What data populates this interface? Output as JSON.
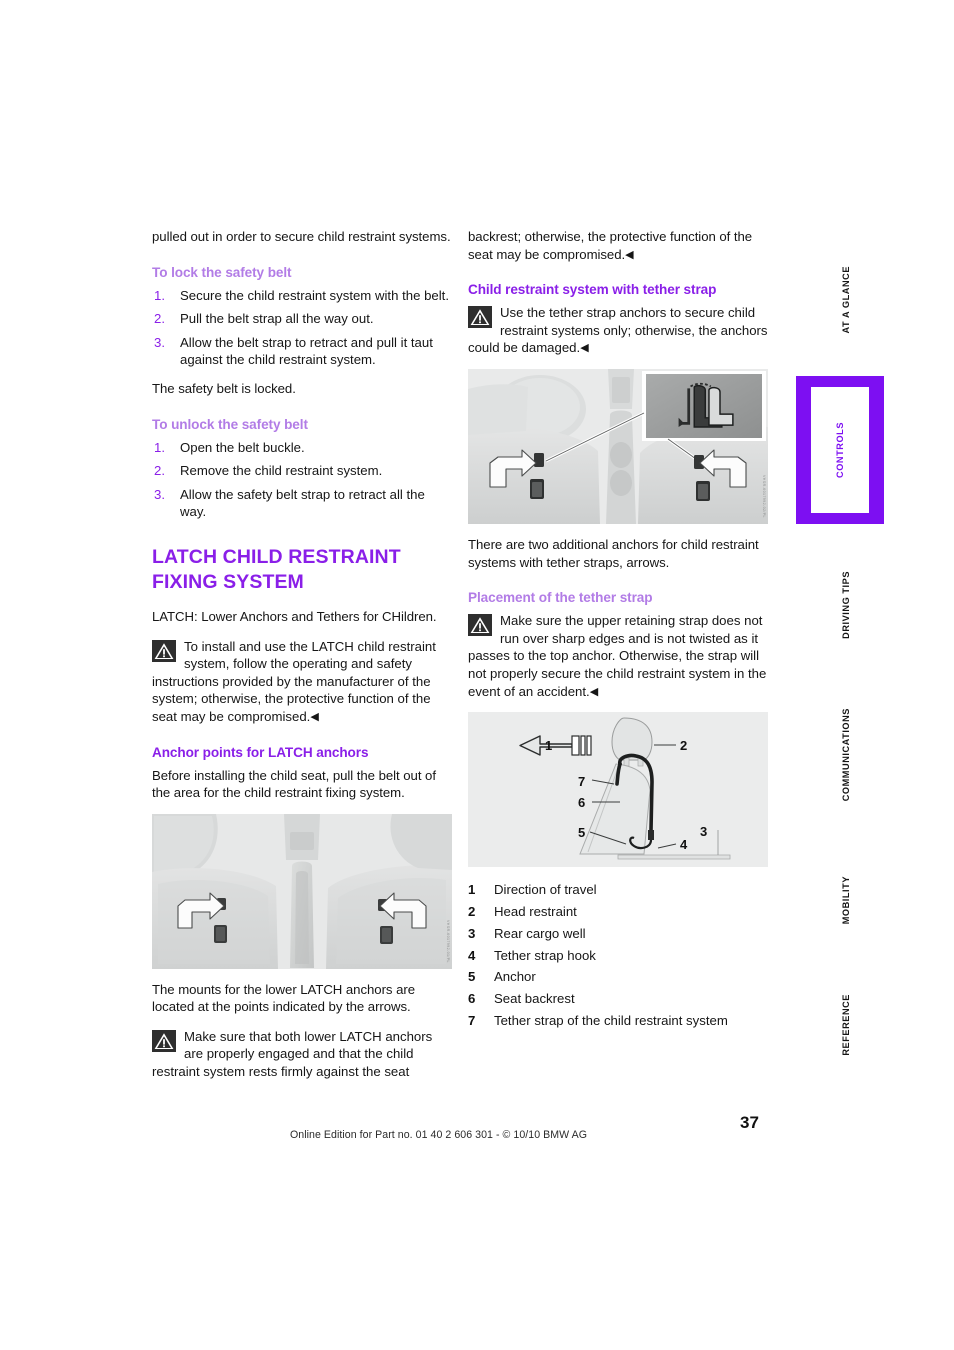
{
  "page": {
    "number": "37",
    "footer": "Online Edition for Part no. 01 40 2 606 301 - © 10/10 BMW AG"
  },
  "left_column": {
    "continued_paragraph": "pulled out in order to secure child restraint systems.",
    "lock_heading": "To lock the safety belt",
    "lock_steps": [
      {
        "num": "1.",
        "text": "Secure the child restraint system with the belt."
      },
      {
        "num": "2.",
        "text": "Pull the belt strap all the way out."
      },
      {
        "num": "3.",
        "text": "Allow the belt strap to retract and pull it taut against the child restraint system."
      }
    ],
    "lock_result": "The safety belt is locked.",
    "unlock_heading": "To unlock the safety belt",
    "unlock_steps": [
      {
        "num": "1.",
        "text": "Open the belt buckle."
      },
      {
        "num": "2.",
        "text": "Remove the child restraint system."
      },
      {
        "num": "3.",
        "text": "Allow the safety belt strap to retract all the way."
      }
    ],
    "latch_title": "LATCH CHILD RESTRAINT FIXING SYSTEM",
    "latch_intro": "LATCH: Lower Anchors and Tethers for CHildren.",
    "latch_warning": "To install and use the LATCH child restraint system, follow the operating and safety instructions provided by the manufacturer of the system; otherwise, the protective function of the seat may be compromised.",
    "anchor_heading": "Anchor points for LATCH anchors",
    "anchor_intro": "Before installing the child seat, pull the belt out of the area for the child restraint fixing system.",
    "figure_anchor": {
      "name": "rear-seat-latch-anchor-photo",
      "credit": "VHSR-6017992-01/PL"
    },
    "anchor_caption": "The mounts for the lower LATCH anchors are located at the points indicated by the arrows.",
    "anchor_warning": "Make sure that both lower LATCH anchors are properly engaged and that the child restraint system rests firmly against the seat"
  },
  "right_column": {
    "continued_paragraph": "backrest; otherwise, the protective function of the seat may be compromised.",
    "tether_heading": "Child restraint system with tether strap",
    "tether_warning": "Use the tether strap anchors to secure child restraint systems only; otherwise, the anchors could be damaged.",
    "figure_tether_anchors": {
      "name": "rear-seat-tether-anchors-photo",
      "credit": "VHSR-6017992-02/PL"
    },
    "tether_caption": "There are two additional anchors for child restraint systems with tether straps, arrows.",
    "placement_heading": "Placement of the tether strap",
    "placement_warning": "Make sure the upper retaining strap does not run over sharp edges and is not twisted as it passes to the top anchor. Otherwise, the strap will not properly secure the child restraint system in the event of an accident.",
    "figure_placement": {
      "name": "tether-strap-routing-diagram",
      "callouts": [
        "1",
        "2",
        "3",
        "4",
        "5",
        "6",
        "7"
      ]
    },
    "legend": [
      {
        "key": "1",
        "label": "Direction of travel"
      },
      {
        "key": "2",
        "label": "Head restraint"
      },
      {
        "key": "3",
        "label": "Rear cargo well"
      },
      {
        "key": "4",
        "label": "Tether strap hook"
      },
      {
        "key": "5",
        "label": "Anchor"
      },
      {
        "key": "6",
        "label": "Seat backrest"
      },
      {
        "key": "7",
        "label": "Tether strap of the child restraint system"
      }
    ]
  },
  "tab_rail": {
    "items": [
      {
        "label": "AT A GLANCE",
        "active": false
      },
      {
        "label": "CONTROLS",
        "active": true
      },
      {
        "label": "DRIVING TIPS",
        "active": false
      },
      {
        "label": "COMMUNICATIONS",
        "active": false
      },
      {
        "label": "MOBILITY",
        "active": false
      },
      {
        "label": "REFERENCE",
        "active": false
      }
    ]
  },
  "colors": {
    "accent_strong": "#8A1FE8",
    "accent_light": "#B27CE6",
    "tab_active": "#7D0FF2"
  },
  "symbols": {
    "warning": "warning-triangle-icon",
    "end_of_note": "◀"
  }
}
